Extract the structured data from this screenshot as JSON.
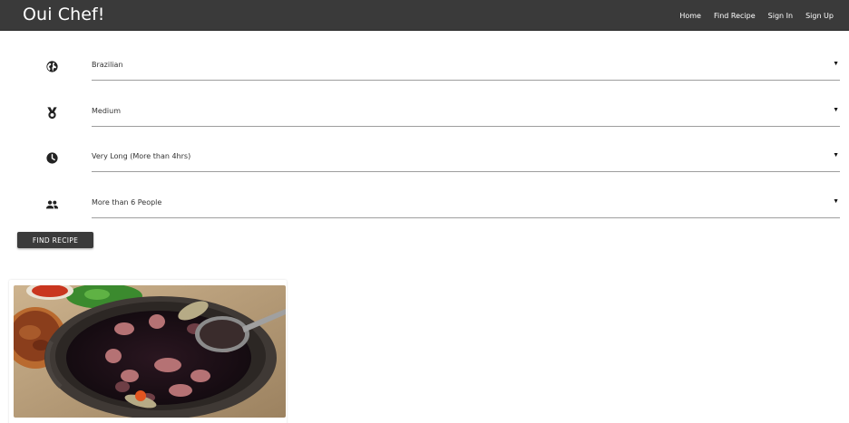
{
  "navbar": {
    "brand": "Oui Chef!",
    "links": [
      "Home",
      "Find Recipe",
      "Sign In",
      "Sign Up"
    ]
  },
  "filters": [
    {
      "icon": "globe-icon",
      "value": "Brazilian"
    },
    {
      "icon": "medal-icon",
      "value": "Medium"
    },
    {
      "icon": "clock-icon",
      "value": "Very Long (More than 4hrs)"
    },
    {
      "icon": "people-icon",
      "value": "More than 6 People"
    }
  ],
  "find_button": "FIND RECIPE",
  "colors": {
    "navbar": "#3a3a3a",
    "button": "#3b3b3b"
  }
}
